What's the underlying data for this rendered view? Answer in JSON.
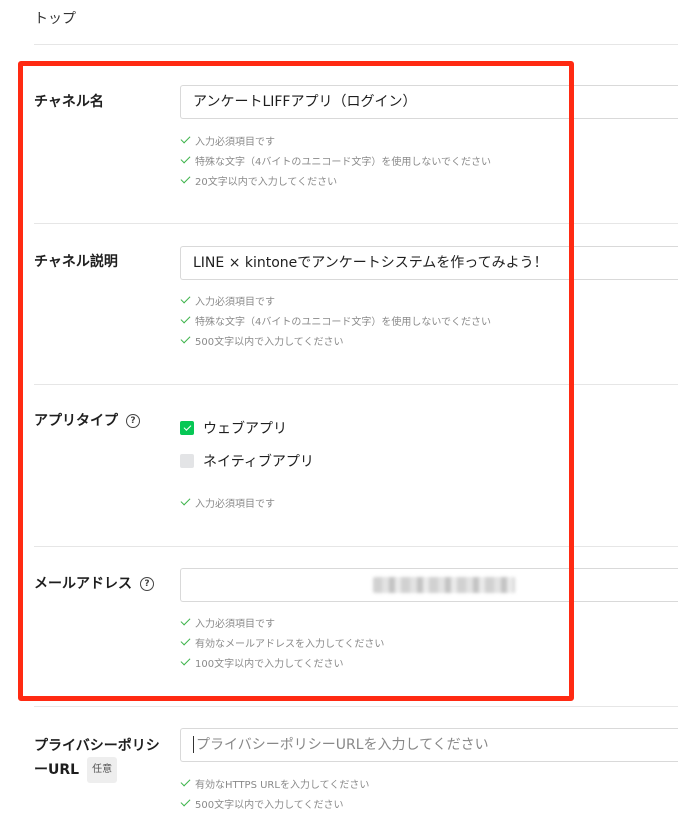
{
  "breadcrumb": {
    "top": "トップ"
  },
  "channel_name": {
    "label": "チャネル名",
    "value": "アンケートLIFFアプリ（ログイン）",
    "hints": [
      "入力必須項目です",
      "特殊な文字（4バイトのユニコード文字）を使用しないでください",
      "20文字以内で入力してください"
    ]
  },
  "channel_description": {
    "label": "チャネル説明",
    "value": "LINE × kintoneでアンケートシステムを作ってみよう！",
    "hints": [
      "入力必須項目です",
      "特殊な文字（4バイトのユニコード文字）を使用しないでください",
      "500文字以内で入力してください"
    ]
  },
  "app_type": {
    "label": "アプリタイプ",
    "help": "?",
    "options": [
      {
        "label": "ウェブアプリ",
        "checked": true
      },
      {
        "label": "ネイティブアプリ",
        "checked": false
      }
    ],
    "hints": [
      "入力必須項目です"
    ]
  },
  "email": {
    "label": "メールアドレス",
    "help": "?",
    "hints": [
      "入力必須項目です",
      "有効なメールアドレスを入力してください",
      "100文字以内で入力してください"
    ]
  },
  "privacy_policy": {
    "label_line1": "プライバシーポリシ",
    "label_line2": "ーURL",
    "optional": "任意",
    "placeholder": "プライバシーポリシーURLを入力してください",
    "hints": [
      "有効なHTTPS URLを入力してください",
      "500文字以内で入力してください"
    ]
  },
  "colors": {
    "highlight": "#ff2a12",
    "check_green": "#3cb34a",
    "checkbox_on": "#06c755"
  }
}
